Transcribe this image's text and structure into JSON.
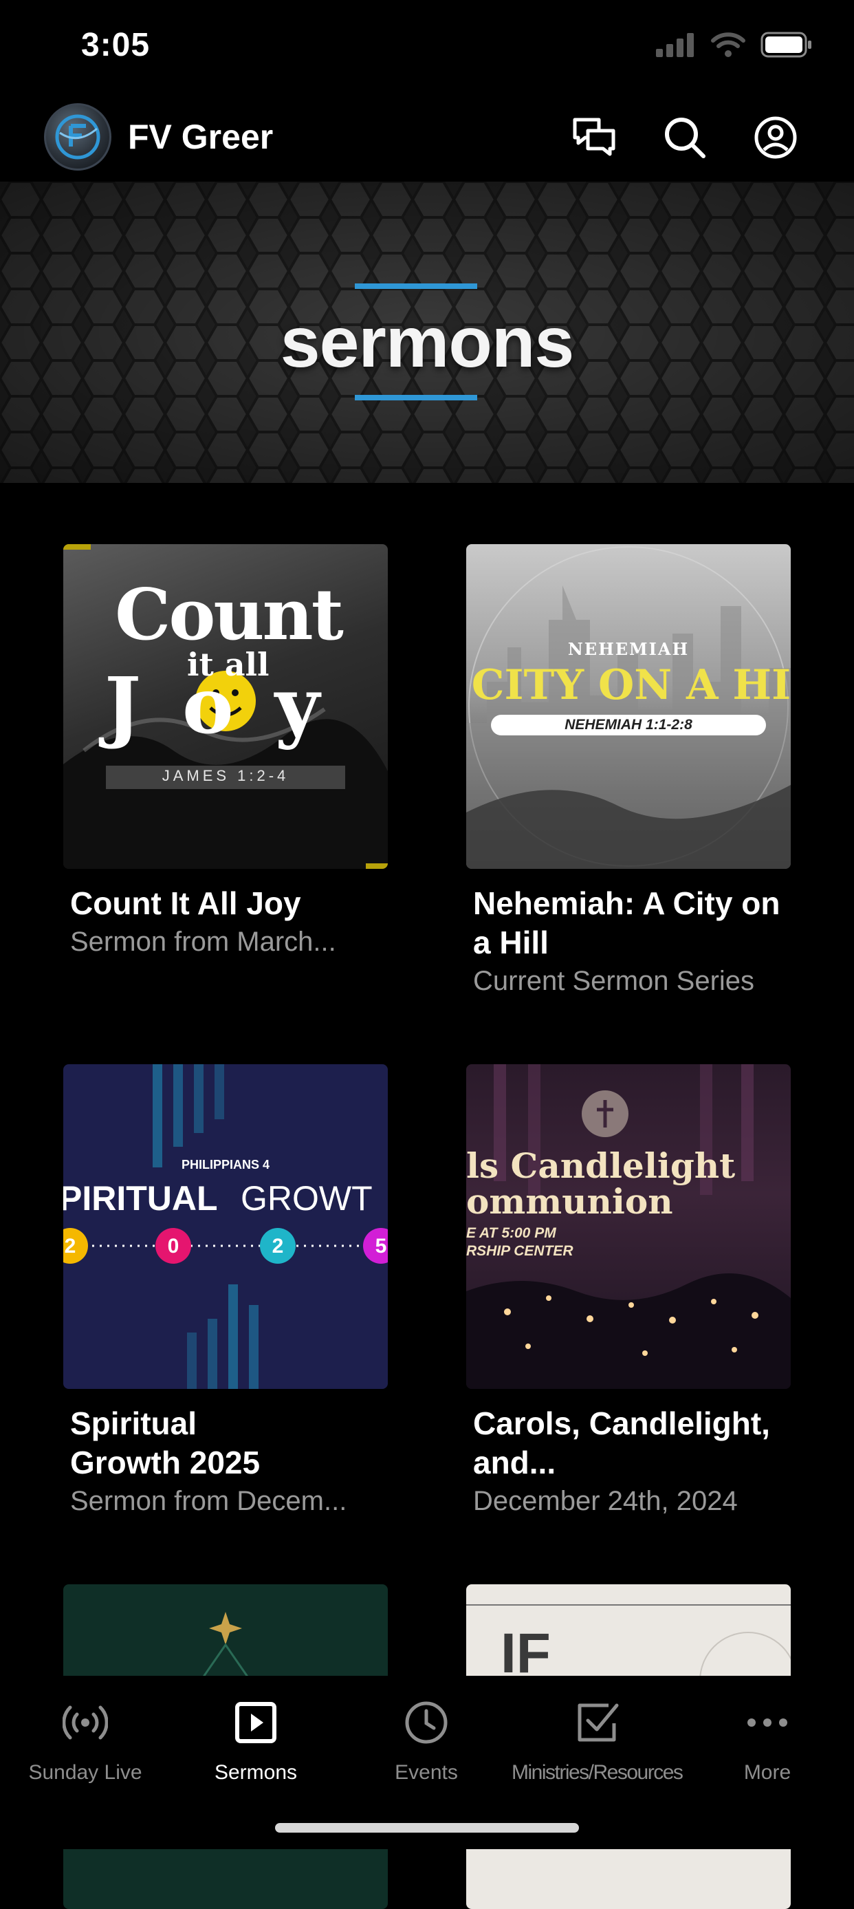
{
  "status_bar": {
    "time": "3:05"
  },
  "header": {
    "app_name": "FV Greer"
  },
  "banner": {
    "title": "sermons",
    "accent_color": "#2f97d6"
  },
  "sermons": [
    {
      "title": "Count It All Joy",
      "subtitle": "Sermon from March...",
      "art": {
        "line1": "Count",
        "line2": "it all",
        "line3": "Joy",
        "reference": "JAMES 1:2-4"
      }
    },
    {
      "title": "Nehemiah: A City on a Hill",
      "subtitle": "Current Sermon Series",
      "art": {
        "kicker": "NEHEMIAH",
        "headline": "CITY ON A HI",
        "reference": "NEHEMIAH 1:1-2:8"
      }
    },
    {
      "title": "Spiritual Growth 2025",
      "subtitle": "Sermon from Decem...",
      "art": {
        "kicker": "PHILIPPIANS 4",
        "word1": "PIRITUAL",
        "word2": "GROWT",
        "digits": [
          "2",
          "0",
          "2",
          "5"
        ]
      }
    },
    {
      "title": "Carols, Candlelight, and...",
      "subtitle": "December 24th, 2024",
      "art": {
        "line1": "ls Candlelight",
        "line2": "ommunion",
        "line3": "E AT 5:00 PM",
        "line4": "RSHIP CENTER"
      }
    },
    {
      "title": "",
      "subtitle": "",
      "art": {}
    },
    {
      "title": "",
      "subtitle": "",
      "art": {
        "headline": "IF"
      }
    }
  ],
  "tabs": [
    {
      "label": "Sunday Live",
      "icon": "broadcast-icon",
      "active": false
    },
    {
      "label": "Sermons",
      "icon": "play-square-icon",
      "active": true
    },
    {
      "label": "Events",
      "icon": "clock-icon",
      "active": false
    },
    {
      "label": "Ministries/Resources",
      "icon": "checkbox-icon",
      "active": false
    },
    {
      "label": "More",
      "icon": "more-dots-icon",
      "active": false
    }
  ]
}
